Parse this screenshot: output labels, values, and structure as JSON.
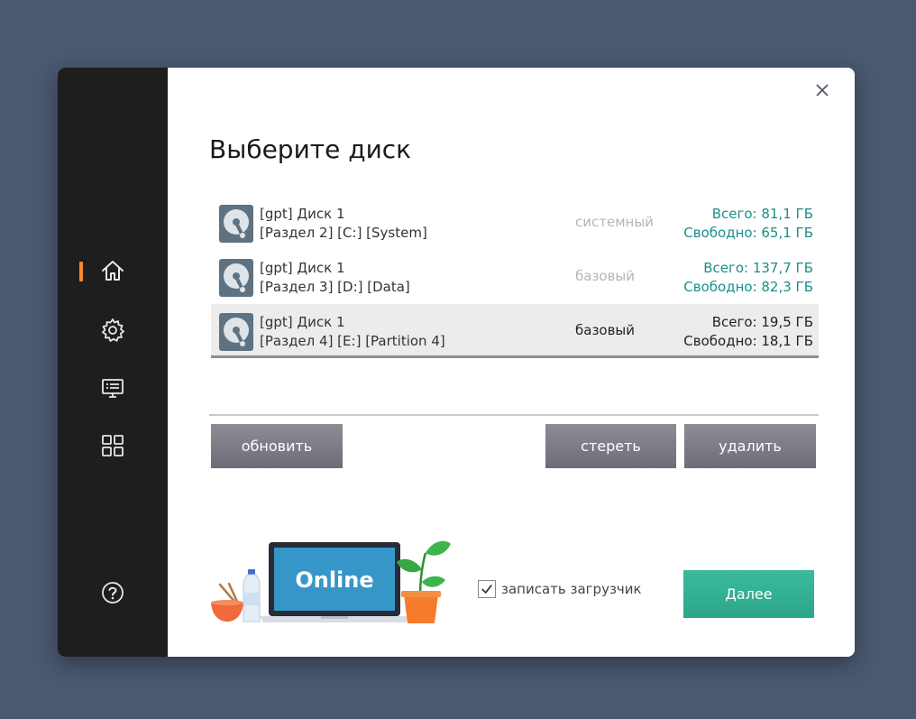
{
  "title": "Выберите диск",
  "sidebar": {
    "items": [
      {
        "icon": "home-icon",
        "active": true
      },
      {
        "icon": "gear-icon",
        "active": false
      },
      {
        "icon": "monitor-icon",
        "active": false
      },
      {
        "icon": "grid-icon",
        "active": false
      }
    ],
    "help_icon": "help-icon",
    "accent": "#f08a3c"
  },
  "disks": [
    {
      "line1": "[gpt] Диск 1",
      "line2": "[Раздел 2] [C:] [System]",
      "type": "системный",
      "total": "Всего: 81,1 ГБ",
      "free": "Свободно: 65,1 ГБ"
    },
    {
      "line1": "[gpt] Диск 1",
      "line2": "[Раздел 3] [D:] [Data]",
      "type": "базовый",
      "total": "Всего: 137,7 ГБ",
      "free": "Свободно: 82,3 ГБ"
    },
    {
      "line1": "[gpt] Диск 1",
      "line2": "[Раздел 4] [E:] [Partition 4]",
      "type": "базовый",
      "total": "Всего: 19,5 ГБ",
      "free": "Свободно: 18,1 ГБ",
      "selected": true
    }
  ],
  "buttons": {
    "refresh": "обновить",
    "erase": "стереть",
    "delete": "удалить",
    "next": "Далее"
  },
  "illustration": {
    "screen_text": "Online"
  },
  "bootloader": {
    "label": "записать загрузчик",
    "checked": true
  },
  "colors": {
    "teal": "#1a8f88",
    "next_button": "#33b092",
    "sidebar": "#1e1e1e",
    "background": "#4a5870"
  }
}
